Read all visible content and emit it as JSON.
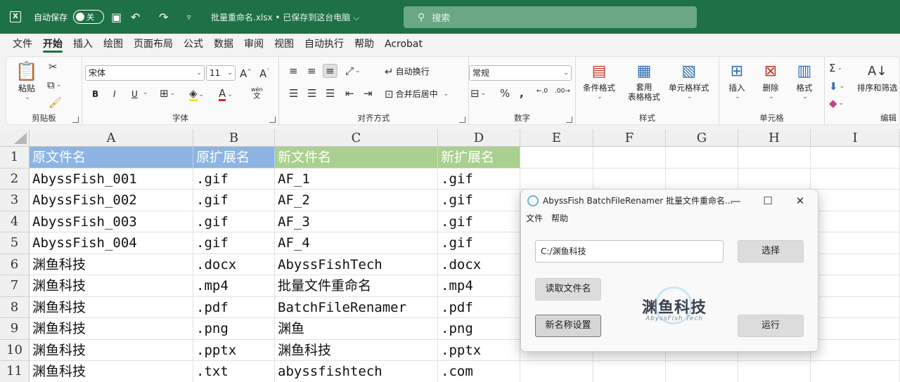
{
  "titlebar": {
    "autosave_label": "自动保存",
    "toggle_state": "关",
    "filename": "批量重命名.xlsx • 已保存到这台电脑 ⌵",
    "search_placeholder": "搜索"
  },
  "menu": [
    "文件",
    "开始",
    "插入",
    "绘图",
    "页面布局",
    "公式",
    "数据",
    "审阅",
    "视图",
    "自动执行",
    "帮助",
    "Acrobat"
  ],
  "ribbon": {
    "clipboard": {
      "label": "剪贴板",
      "paste": "粘贴"
    },
    "font": {
      "label": "字体",
      "family": "宋体",
      "size": "11",
      "bold": "B",
      "italic": "I",
      "underline": "U",
      "phonetic_top": "wén",
      "phonetic_bottom": "文"
    },
    "alignment": {
      "label": "对齐方式",
      "wrap": "自动换行",
      "merge": "合并后居中"
    },
    "number": {
      "label": "数字",
      "format": "常规"
    },
    "styles": {
      "label": "样式",
      "cond_line1": "条件格式",
      "table_line1": "套用",
      "table_line2": "表格格式",
      "cell_styles": "单元格样式"
    },
    "cells": {
      "label": "单元格",
      "insert": "插入",
      "delete": "删除",
      "format": "格式"
    },
    "editing": {
      "label": "编辑",
      "sort": "排序和筛选"
    }
  },
  "grid": {
    "columns": [
      "A",
      "B",
      "C",
      "D",
      "E",
      "F",
      "G",
      "H",
      "I"
    ],
    "rows": [
      [
        "原文件名",
        "原扩展名",
        "新文件名",
        "新扩展名"
      ],
      [
        "AbyssFish_001",
        ".gif",
        "AF_1",
        ".gif"
      ],
      [
        "AbyssFish_002",
        ".gif",
        "AF_2",
        ".gif"
      ],
      [
        "AbyssFish_003",
        ".gif",
        "AF_3",
        ".gif"
      ],
      [
        "AbyssFish_004",
        ".gif",
        "AF_4",
        ".gif"
      ],
      [
        "渊鱼科技",
        ".docx",
        "AbyssFishTech",
        ".docx"
      ],
      [
        "渊鱼科技",
        ".mp4",
        "批量文件重命名",
        ".mp4"
      ],
      [
        "渊鱼科技",
        ".pdf",
        "BatchFileRenamer",
        ".pdf"
      ],
      [
        "渊鱼科技",
        ".png",
        "渊鱼",
        ".png"
      ],
      [
        "渊鱼科技",
        ".pptx",
        "渊鱼科技",
        ".pptx"
      ],
      [
        "渊鱼科技",
        ".txt",
        "abyssfishtech",
        ".com"
      ]
    ],
    "header_colors": {
      "blue": "#8db4e2",
      "green": "#a9d08e"
    }
  },
  "dialog": {
    "title": "AbyssFish BatchFileRenamer 批量文件重命名...",
    "menu_file": "文件",
    "menu_help": "帮助",
    "path_value": "C:/渊鱼科技",
    "select_button": "选择",
    "read_button": "读取文件名",
    "new_name_button": "新名称设置",
    "run_button": "运行",
    "watermark_main": "渊鱼科技",
    "watermark_sub": "AbyssFish Tech"
  }
}
